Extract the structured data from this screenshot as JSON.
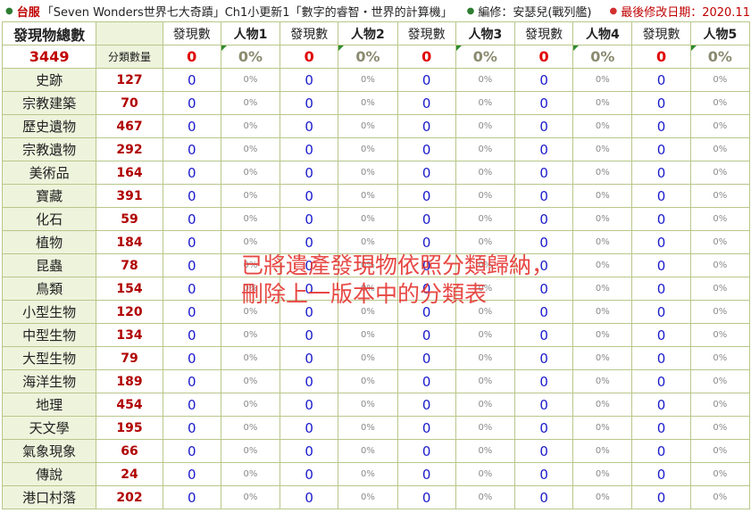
{
  "topbar": {
    "region": "台服",
    "title": "「Seven Wonders世界七大奇蹟」Ch1小更新1「數字的睿智・世界的計算機」",
    "editor": "編修：安瑟兒(戰列艦)",
    "date": "最後修改日期：2020.11"
  },
  "header": {
    "total_label": "發現物總數",
    "total_value": "3449",
    "sub_label": "分類數量",
    "found_label": "發現數",
    "characters": [
      "人物1",
      "人物2",
      "人物3",
      "人物4",
      "人物5"
    ],
    "found_totals": [
      "0",
      "0",
      "0",
      "0",
      "0"
    ],
    "percent_totals": [
      "0%",
      "0%",
      "0%",
      "0%",
      "0%"
    ]
  },
  "rows": [
    {
      "name": "史跡",
      "count": "127",
      "found": [
        "0",
        "0",
        "0",
        "0",
        "0"
      ],
      "pct": [
        "0%",
        "0%",
        "0%",
        "0%",
        "0%"
      ]
    },
    {
      "name": "宗教建築",
      "count": "70",
      "found": [
        "0",
        "0",
        "0",
        "0",
        "0"
      ],
      "pct": [
        "0%",
        "0%",
        "0%",
        "0%",
        "0%"
      ]
    },
    {
      "name": "歷史遺物",
      "count": "467",
      "found": [
        "0",
        "0",
        "0",
        "0",
        "0"
      ],
      "pct": [
        "0%",
        "0%",
        "0%",
        "0%",
        "0%"
      ]
    },
    {
      "name": "宗教遺物",
      "count": "292",
      "found": [
        "0",
        "0",
        "0",
        "0",
        "0"
      ],
      "pct": [
        "0%",
        "0%",
        "0%",
        "0%",
        "0%"
      ]
    },
    {
      "name": "美術品",
      "count": "164",
      "found": [
        "0",
        "0",
        "0",
        "0",
        "0"
      ],
      "pct": [
        "0%",
        "0%",
        "0%",
        "0%",
        "0%"
      ]
    },
    {
      "name": "寶藏",
      "count": "391",
      "found": [
        "0",
        "0",
        "0",
        "0",
        "0"
      ],
      "pct": [
        "0%",
        "0%",
        "0%",
        "0%",
        "0%"
      ]
    },
    {
      "name": "化石",
      "count": "59",
      "found": [
        "0",
        "0",
        "0",
        "0",
        "0"
      ],
      "pct": [
        "0%",
        "0%",
        "0%",
        "0%",
        "0%"
      ]
    },
    {
      "name": "植物",
      "count": "184",
      "found": [
        "0",
        "0",
        "0",
        "0",
        "0"
      ],
      "pct": [
        "0%",
        "0%",
        "0%",
        "0%",
        "0%"
      ]
    },
    {
      "name": "昆蟲",
      "count": "78",
      "found": [
        "0",
        "0",
        "0",
        "0",
        "0"
      ],
      "pct": [
        "0%",
        "0%",
        "0%",
        "0%",
        "0%"
      ]
    },
    {
      "name": "鳥類",
      "count": "154",
      "found": [
        "0",
        "0",
        "0",
        "0",
        "0"
      ],
      "pct": [
        "0%",
        "0%",
        "0%",
        "0%",
        "0%"
      ]
    },
    {
      "name": "小型生物",
      "count": "120",
      "found": [
        "0",
        "0",
        "0",
        "0",
        "0"
      ],
      "pct": [
        "0%",
        "0%",
        "0%",
        "0%",
        "0%"
      ]
    },
    {
      "name": "中型生物",
      "count": "134",
      "found": [
        "0",
        "0",
        "0",
        "0",
        "0"
      ],
      "pct": [
        "0%",
        "0%",
        "0%",
        "0%",
        "0%"
      ]
    },
    {
      "name": "大型生物",
      "count": "79",
      "found": [
        "0",
        "0",
        "0",
        "0",
        "0"
      ],
      "pct": [
        "0%",
        "0%",
        "0%",
        "0%",
        "0%"
      ]
    },
    {
      "name": "海洋生物",
      "count": "189",
      "found": [
        "0",
        "0",
        "0",
        "0",
        "0"
      ],
      "pct": [
        "0%",
        "0%",
        "0%",
        "0%",
        "0%"
      ]
    },
    {
      "name": "地理",
      "count": "454",
      "found": [
        "0",
        "0",
        "0",
        "0",
        "0"
      ],
      "pct": [
        "0%",
        "0%",
        "0%",
        "0%",
        "0%"
      ]
    },
    {
      "name": "天文學",
      "count": "195",
      "found": [
        "0",
        "0",
        "0",
        "0",
        "0"
      ],
      "pct": [
        "0%",
        "0%",
        "0%",
        "0%",
        "0%"
      ]
    },
    {
      "name": "氣象現象",
      "count": "66",
      "found": [
        "0",
        "0",
        "0",
        "0",
        "0"
      ],
      "pct": [
        "0%",
        "0%",
        "0%",
        "0%",
        "0%"
      ]
    },
    {
      "name": "傳說",
      "count": "24",
      "found": [
        "0",
        "0",
        "0",
        "0",
        "0"
      ],
      "pct": [
        "0%",
        "0%",
        "0%",
        "0%",
        "0%"
      ]
    },
    {
      "name": "港口村落",
      "count": "202",
      "found": [
        "0",
        "0",
        "0",
        "0",
        "0"
      ],
      "pct": [
        "0%",
        "0%",
        "0%",
        "0%",
        "0%"
      ]
    }
  ],
  "overlay_note": {
    "line1": "已將遺產發現物依照分類歸納，",
    "line2": "刪除上一版本中的分類表"
  }
}
